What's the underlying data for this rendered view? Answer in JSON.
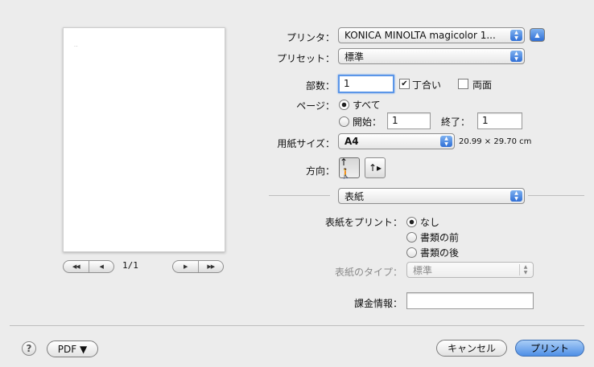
{
  "preview": {
    "mark": "...",
    "page_indicator": "1/1",
    "first_symbol": "◀◀",
    "prev_symbol": "◀",
    "next_symbol": "▶",
    "last_symbol": "▶▶"
  },
  "printer": {
    "label": "プリンタ：",
    "value": "KONICA MINOLTA magicolor 1...",
    "expand_symbol": "▲"
  },
  "preset": {
    "label": "プリセット：",
    "value": "標準"
  },
  "copies": {
    "label": "部数：",
    "value": "1",
    "collate_label": "丁合い",
    "collate_checked": true,
    "duplex_label": "両面",
    "duplex_checked": false
  },
  "pages": {
    "label": "ページ：",
    "all_label": "すべて",
    "from_label": "開始：",
    "from_value": "1",
    "to_label": "終了：",
    "to_value": "1",
    "selected": "all"
  },
  "paper_size": {
    "label": "用紙サイズ：",
    "value": "A4",
    "dimensions": "20.99 × 29.70 cm"
  },
  "orientation": {
    "label": "方向：",
    "selected": "portrait"
  },
  "section": {
    "value": "表紙"
  },
  "cover_page": {
    "label": "表紙をプリント：",
    "options": [
      "なし",
      "書類の前",
      "書類の後"
    ],
    "selected_index": 0,
    "type_label": "表紙のタイプ：",
    "type_value": "標準"
  },
  "billing": {
    "label": "課金情報：",
    "value": ""
  },
  "buttons": {
    "help": "?",
    "pdf": "PDF ▼",
    "cancel": "キャンセル",
    "print": "プリント"
  },
  "colors": {
    "accent": "#4f8fe6",
    "background": "#ececec"
  }
}
